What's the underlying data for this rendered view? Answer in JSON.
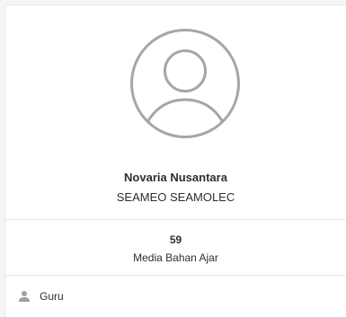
{
  "profile": {
    "name": "Novaria Nusantara",
    "organization": "SEAMEO SEAMOLEC",
    "avatar_icon": "user-circle-icon"
  },
  "stats": {
    "value": "59",
    "label": "Media Bahan Ajar"
  },
  "role": {
    "icon": "user-icon",
    "label": "Guru"
  },
  "colors": {
    "avatar_stroke": "#a2a7ad",
    "text": "#2b2f33",
    "divider": "#e6e8eb",
    "icon": "#9aa0a6"
  }
}
